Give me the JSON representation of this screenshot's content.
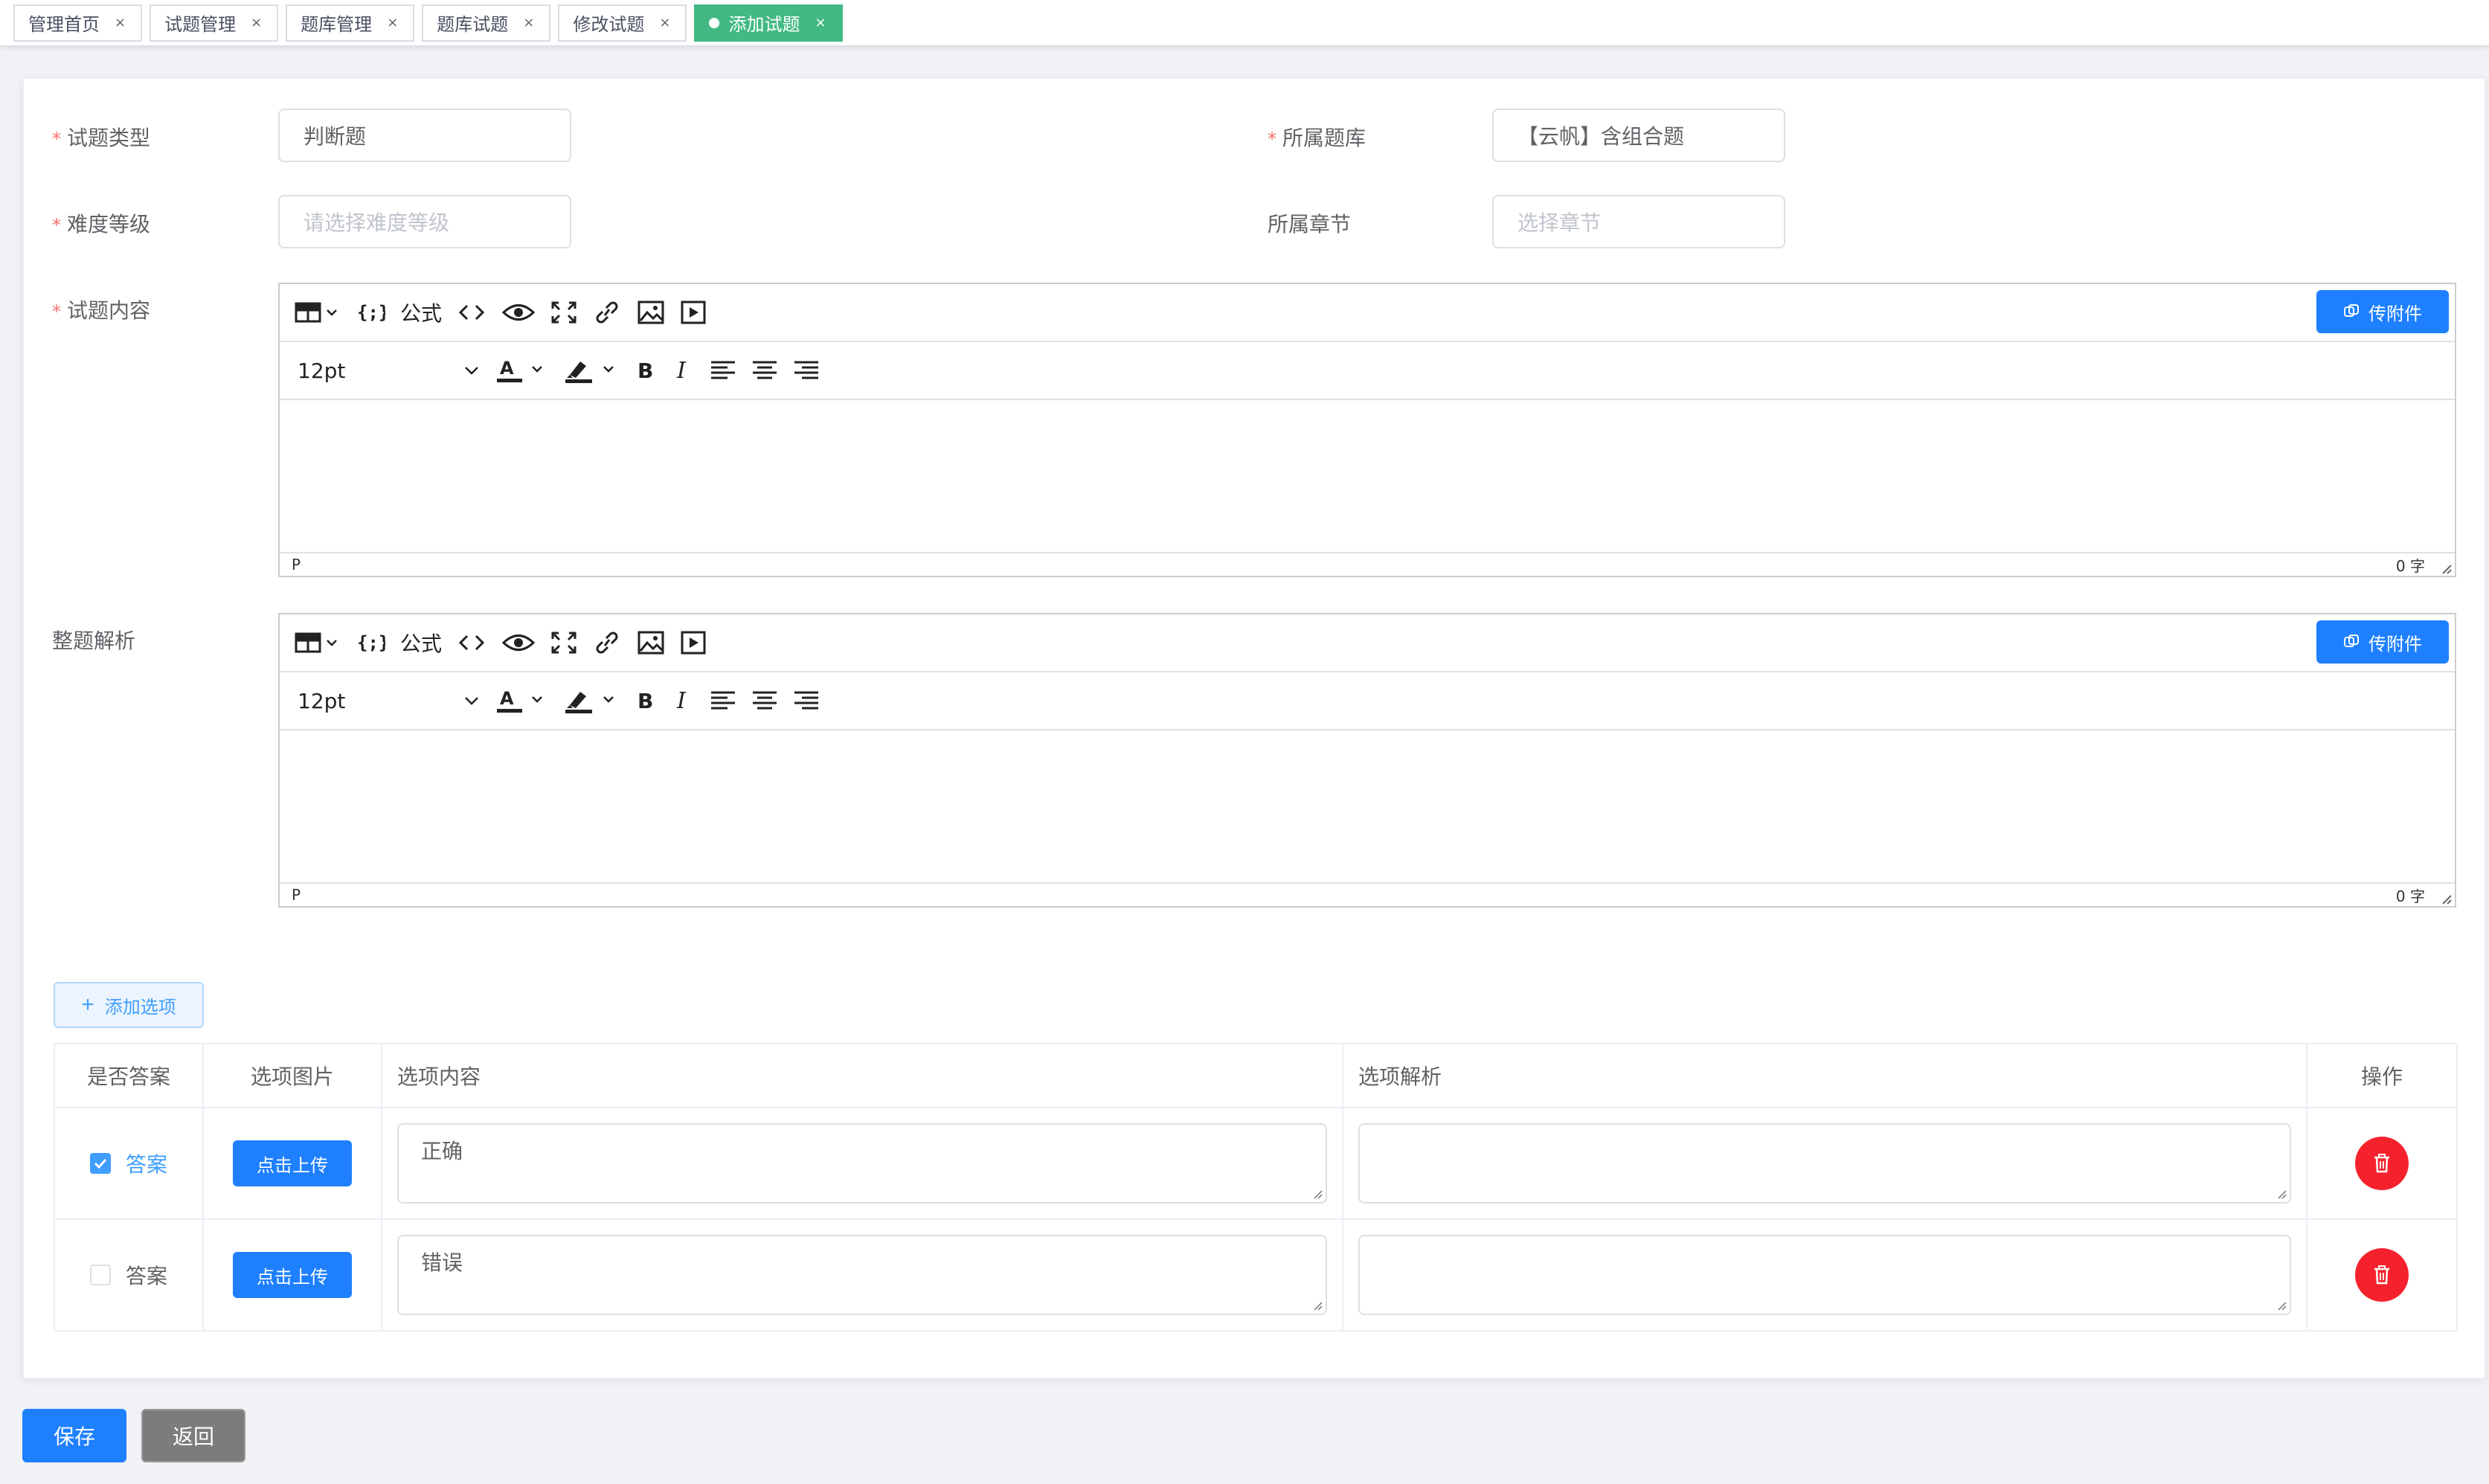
{
  "tabs": [
    {
      "label": "管理首页",
      "active": false
    },
    {
      "label": "试题管理",
      "active": false
    },
    {
      "label": "题库管理",
      "active": false
    },
    {
      "label": "题库试题",
      "active": false
    },
    {
      "label": "修改试题",
      "active": false
    },
    {
      "label": "添加试题",
      "active": true
    }
  ],
  "tab_close_glyph": "×",
  "form": {
    "question_type": {
      "label": "试题类型",
      "value": "判断题",
      "required": true
    },
    "question_bank": {
      "label": "所属题库",
      "value": "【云帆】含组合题",
      "required": true
    },
    "difficulty": {
      "label": "难度等级",
      "placeholder": "请选择难度等级",
      "required": true
    },
    "chapter": {
      "label": "所属章节",
      "placeholder": "选择章节",
      "required": false
    },
    "content": {
      "label": "试题内容",
      "required": true
    },
    "analysis": {
      "label": "整题解析",
      "required": false
    }
  },
  "required_mark": "*",
  "editor": {
    "formula_label": "公式",
    "font_size": "12pt",
    "attach_label": "传附件",
    "status_path": "P",
    "word_count": "0 字",
    "icons": [
      "table-icon",
      "code-braces-icon",
      "code-view-icon",
      "preview-icon",
      "fullscreen-icon",
      "link-icon",
      "image-icon",
      "media-icon",
      "font-color-icon",
      "highlight-icon",
      "bold-icon",
      "italic-icon",
      "align-left-icon",
      "align-center-icon",
      "align-right-icon"
    ]
  },
  "options": {
    "add_label": "添加选项",
    "headers": [
      "是否答案",
      "选项图片",
      "选项内容",
      "选项解析",
      "操作"
    ],
    "upload_label": "点击上传",
    "answer_label": "答案",
    "rows": [
      {
        "is_answer": true,
        "content": "正确",
        "analysis": ""
      },
      {
        "is_answer": false,
        "content": "错误",
        "analysis": ""
      }
    ]
  },
  "actions": {
    "save": "保存",
    "back": "返回"
  },
  "colors": {
    "primary": "#1e80ff",
    "active_tab": "#42b983",
    "danger": "#f5222d",
    "required": "#f56c6c"
  }
}
